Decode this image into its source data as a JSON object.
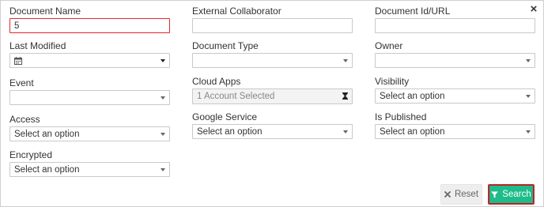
{
  "close_glyph": "×",
  "fields": {
    "document_name": {
      "label": "Document Name",
      "value": "5"
    },
    "external_collaborator": {
      "label": "External Collaborator",
      "value": ""
    },
    "document_id_url": {
      "label": "Document Id/URL",
      "value": ""
    },
    "last_modified": {
      "label": "Last Modified",
      "value": ""
    },
    "document_type": {
      "label": "Document Type",
      "value": ""
    },
    "owner": {
      "label": "Owner",
      "value": ""
    },
    "event": {
      "label": "Event",
      "value": ""
    },
    "cloud_apps": {
      "label": "Cloud Apps",
      "value": "1 Account Selected"
    },
    "visibility": {
      "label": "Visibility",
      "value": "Select an option"
    },
    "access": {
      "label": "Access",
      "value": "Select an option"
    },
    "google_service": {
      "label": "Google Service",
      "value": "Select an option"
    },
    "is_published": {
      "label": "Is Published",
      "value": "Select an option"
    },
    "encrypted": {
      "label": "Encrypted",
      "value": "Select an option"
    }
  },
  "buttons": {
    "reset_label": "Reset",
    "search_label": "Search"
  },
  "icons": {
    "close": "close-icon",
    "calendar": "calendar-icon",
    "hourglass": "hourglass-icon",
    "reset": "x-icon",
    "search": "filter-icon"
  },
  "colors": {
    "focus_border": "#e0282e",
    "search_button": "#1ebc8a",
    "reset_button": "#eeeeee"
  }
}
